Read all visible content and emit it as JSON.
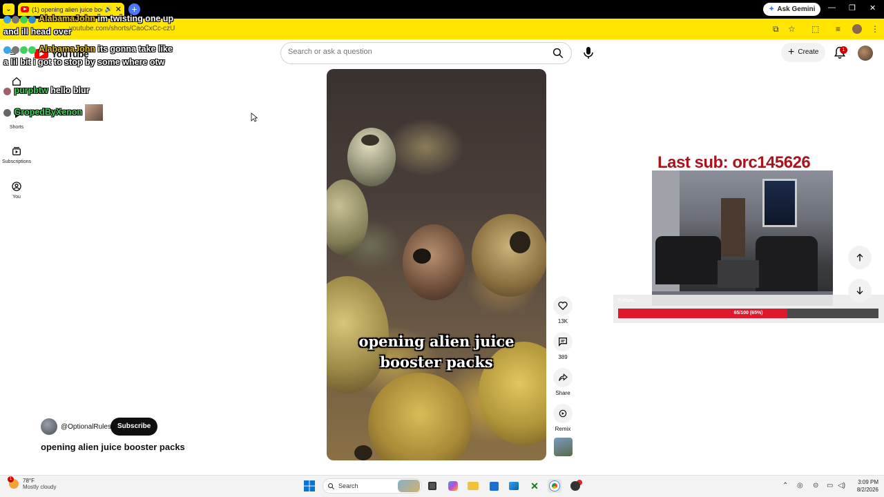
{
  "browser": {
    "tab_title": "(1) opening alien juice boo",
    "url": "youtube.com/shorts/CaoCxCc-czU",
    "ask_gemini_label": "Ask Gemini"
  },
  "youtube": {
    "logo_text": "YouTube",
    "search_placeholder": "Search or ask a question",
    "create_label": "Create",
    "notification_count": "1",
    "sidebar": [
      {
        "label": ""
      },
      {
        "label": "Shorts"
      },
      {
        "label": "Subscriptions"
      },
      {
        "label": "You"
      }
    ]
  },
  "chat": [
    {
      "user": "AlabamaJohn",
      "message": "im twisting one up and ill head over"
    },
    {
      "user": "AlabamaJohn",
      "message": "its gonna take like a lil bit i got to stop by some where otw"
    },
    {
      "user": "purpbtw",
      "message": "hello blur"
    },
    {
      "user": "GropedByXenon",
      "message": ""
    }
  ],
  "video": {
    "caption": "opening alien juice booster packs",
    "likes": "13K",
    "comments": "389",
    "share_label": "Share",
    "remix_label": "Remix"
  },
  "channel": {
    "handle": "@OptionalRules",
    "subscribe_label": "Subscribe",
    "video_title": "opening alien juice booster packs"
  },
  "overlay": {
    "last_sub": "Last sub: orc145626",
    "follows_label": "Follows",
    "follow_goal_text": "65/100 (65%)",
    "follow_progress": 0.65
  },
  "taskbar": {
    "weather_temp": "78°F",
    "weather_desc": "Mostly cloudy",
    "weather_badge": "1",
    "search_label": "Search",
    "time": "3:09 PM",
    "date": "8/2/2026"
  }
}
